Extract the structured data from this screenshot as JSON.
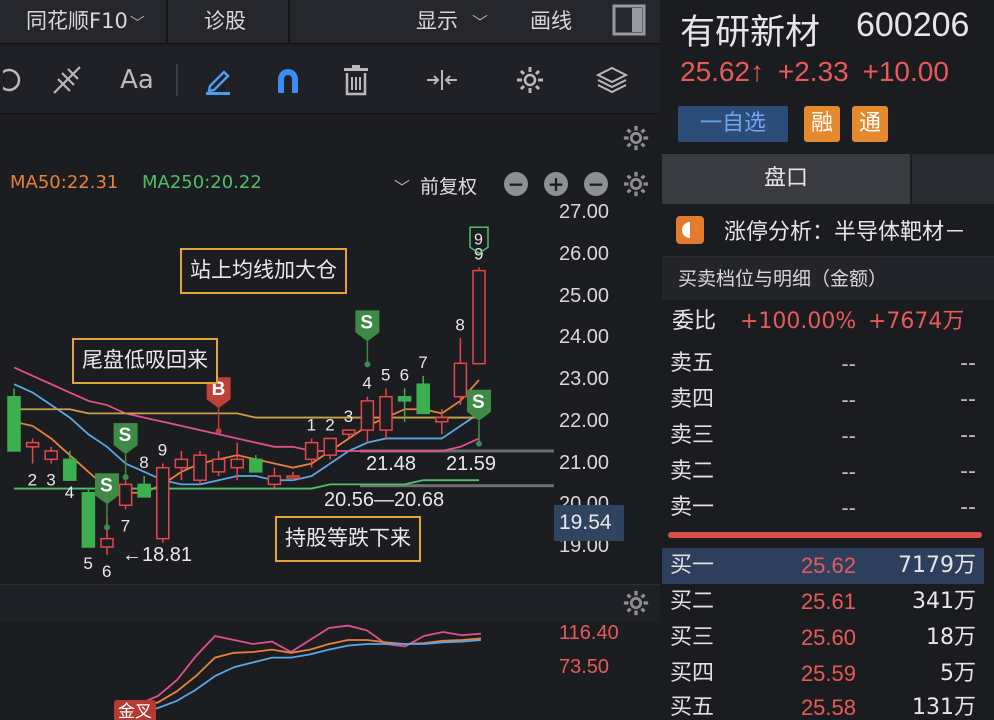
{
  "topbar": {
    "app_label": "同花顺F10",
    "diagnose_label": "诊股",
    "display_label": "显示",
    "draw_label": "画线"
  },
  "toolbar": {
    "font_label": "Aa"
  },
  "ma_row": {
    "ma50": "MA50:22.31",
    "ma250": "MA250:20.22",
    "adjust_label": "前复权",
    "colors": {
      "ma50": "#e8813a",
      "ma250": "#4fbf6a"
    }
  },
  "chart_data": {
    "type": "candlestick",
    "ylim": [
      18.8,
      27.2
    ],
    "y_ticks": [
      "27.00",
      "26.00",
      "25.00",
      "24.00",
      "23.00",
      "22.00",
      "21.00",
      "20.00",
      "19.00"
    ],
    "current_price": "19.54",
    "candles": [
      {
        "o": 22.6,
        "h": 22.8,
        "l": 21.3,
        "c": 21.3
      },
      {
        "o": 21.4,
        "h": 21.6,
        "l": 21.0,
        "c": 21.5
      },
      {
        "o": 21.1,
        "h": 21.4,
        "l": 21.0,
        "c": 21.3
      },
      {
        "o": 21.1,
        "h": 21.3,
        "l": 20.7,
        "c": 20.6
      },
      {
        "o": 20.3,
        "h": 20.4,
        "l": 19.0,
        "c": 19.0
      },
      {
        "o": 19.0,
        "h": 19.7,
        "l": 18.81,
        "c": 19.2
      },
      {
        "o": 20.0,
        "h": 20.6,
        "l": 19.9,
        "c": 20.5
      },
      {
        "o": 20.5,
        "h": 20.7,
        "l": 20.2,
        "c": 20.2
      },
      {
        "o": 19.2,
        "h": 21.0,
        "l": 19.1,
        "c": 20.9
      },
      {
        "o": 20.9,
        "h": 21.3,
        "l": 20.6,
        "c": 21.1
      },
      {
        "o": 20.6,
        "h": 21.3,
        "l": 20.5,
        "c": 21.2
      },
      {
        "o": 20.8,
        "h": 21.3,
        "l": 20.7,
        "c": 21.1
      },
      {
        "o": 20.9,
        "h": 21.5,
        "l": 20.6,
        "c": 21.1
      },
      {
        "o": 21.1,
        "h": 21.2,
        "l": 20.8,
        "c": 20.8
      },
      {
        "o": 20.5,
        "h": 20.9,
        "l": 20.4,
        "c": 20.7
      },
      {
        "o": 20.7,
        "h": 20.8,
        "l": 20.6,
        "c": 20.7
      },
      {
        "o": 21.1,
        "h": 21.6,
        "l": 20.9,
        "c": 21.5
      },
      {
        "o": 21.2,
        "h": 21.6,
        "l": 21.1,
        "c": 21.6
      },
      {
        "o": 21.7,
        "h": 21.8,
        "l": 21.6,
        "c": 21.8
      },
      {
        "o": 21.8,
        "h": 22.6,
        "l": 21.5,
        "c": 22.5
      },
      {
        "o": 21.8,
        "h": 22.8,
        "l": 21.6,
        "c": 22.6
      },
      {
        "o": 22.6,
        "h": 22.8,
        "l": 22.0,
        "c": 22.5
      },
      {
        "o": 22.9,
        "h": 23.1,
        "l": 22.2,
        "c": 22.2
      },
      {
        "o": 22.0,
        "h": 22.3,
        "l": 21.7,
        "c": 22.1
      },
      {
        "o": 22.6,
        "h": 24.0,
        "l": 22.4,
        "c": 23.4
      },
      {
        "o": 23.39,
        "h": 25.7,
        "l": 23.39,
        "c": 25.62
      }
    ],
    "candle_labels": [
      "",
      "2",
      "3",
      "4",
      "5",
      "6",
      "7",
      "8",
      "9",
      "",
      "",
      "",
      "",
      "",
      "",
      "",
      "1",
      "2",
      "3",
      "4",
      "5",
      "6",
      "7",
      "",
      "8",
      "9"
    ],
    "ma_lines": [
      {
        "name": "MA50",
        "color": "#e8813a",
        "values": [
          22.0,
          21.9,
          21.6,
          21.2,
          20.8,
          20.4,
          20.3,
          20.3,
          20.5,
          20.8,
          21.0,
          21.1,
          21.2,
          21.1,
          21.0,
          20.9,
          21.0,
          21.3,
          21.6,
          21.9,
          22.1,
          22.3,
          22.3,
          22.2,
          22.5,
          23.0
        ]
      },
      {
        "name": "MA250",
        "color": "#4fbf6a",
        "values": [
          20.4,
          20.4,
          20.4,
          20.4,
          20.4,
          20.4,
          20.4,
          20.4,
          20.4,
          20.4,
          20.4,
          20.4,
          20.4,
          20.4,
          20.4,
          20.4,
          20.4,
          20.5,
          20.5,
          20.5,
          20.5,
          20.5,
          20.6,
          20.6,
          20.6,
          20.6
        ]
      },
      {
        "name": "",
        "color": "#5aa7e6",
        "values": [
          22.9,
          22.7,
          22.4,
          22.1,
          21.7,
          21.4,
          21.0,
          20.8,
          20.6,
          20.5,
          20.5,
          20.6,
          20.7,
          20.7,
          20.6,
          20.6,
          20.7,
          21.0,
          21.3,
          21.5,
          21.6,
          21.6,
          21.6,
          21.6,
          21.9,
          22.2
        ]
      },
      {
        "name": "",
        "color": "#e0508f",
        "values": [
          23.3,
          23.1,
          22.9,
          22.7,
          22.5,
          22.4,
          22.2,
          22.1,
          22.0,
          21.9,
          21.8,
          21.7,
          21.6,
          21.5,
          21.4,
          21.4,
          21.3,
          21.3,
          21.3,
          21.3,
          21.3,
          21.3,
          21.3,
          21.3,
          21.4,
          21.6
        ]
      },
      {
        "name": "",
        "color": "#c9a24a",
        "values": [
          22.3,
          22.3,
          22.3,
          22.3,
          22.2,
          22.2,
          22.2,
          22.2,
          22.2,
          22.2,
          22.2,
          22.2,
          22.2,
          22.1,
          22.1,
          22.1,
          22.1,
          22.1,
          22.1,
          22.1,
          22.1,
          22.1,
          22.1,
          22.1,
          22.1,
          22.1
        ]
      }
    ],
    "signals": [
      {
        "label": "S",
        "idx": 5,
        "price": 20.0
      },
      {
        "label": "S",
        "idx": 6,
        "price": 21.2
      },
      {
        "label": "B",
        "idx": 11,
        "price": 22.3
      },
      {
        "label": "S",
        "idx": 19,
        "price": 23.9
      },
      {
        "label": "S",
        "idx": 25,
        "price": 22.0
      }
    ],
    "price_notes": [
      "←18.81",
      "21.48",
      "21.59",
      "20.56—20.68"
    ],
    "annotations": [
      "站上均线加大仓",
      "尾盘低吸回来",
      "持股等跌下来"
    ],
    "top_badge": "9",
    "sub_ticks": [
      "116.40",
      "73.50"
    ],
    "sub_badge": "金叉",
    "sub_lines": [
      {
        "color": "#e0508f",
        "values": [
          10,
          20,
          30,
          50,
          80,
          105,
          100,
          95,
          98,
          85,
          100,
          115,
          118,
          112,
          95,
          92,
          105,
          110,
          106,
          108
        ]
      },
      {
        "color": "#e8813a",
        "values": [
          8,
          15,
          22,
          36,
          55,
          78,
          84,
          85,
          88,
          84,
          88,
          95,
          100,
          100,
          97,
          95,
          96,
          99,
          100,
          102
        ]
      },
      {
        "color": "#5aa7e6",
        "values": [
          5,
          10,
          15,
          24,
          38,
          55,
          66,
          72,
          78,
          78,
          82,
          88,
          93,
          95,
          95,
          95,
          95,
          97,
          98,
          100
        ]
      }
    ]
  },
  "stock": {
    "name": "有研新材",
    "code": "600206",
    "price": "25.62",
    "arrow": "↑",
    "change": "+2.33",
    "change_pct": "+10.00",
    "watch_label": "一自选",
    "tag1": "融",
    "tag2": "通",
    "tab_label": "盘口",
    "limitup": "涨停分析：半导体靶材－"
  },
  "orderbook": {
    "title": "买卖档位与明细（金额）",
    "weibi_label": "委比",
    "weibi_pct": "+100.00%",
    "weibi_amt": "+7674万",
    "sells": [
      {
        "label": "卖五",
        "price": "--",
        "vol": "--"
      },
      {
        "label": "卖四",
        "price": "--",
        "vol": "--"
      },
      {
        "label": "卖三",
        "price": "--",
        "vol": "--"
      },
      {
        "label": "卖二",
        "price": "--",
        "vol": "--"
      },
      {
        "label": "卖一",
        "price": "--",
        "vol": "--"
      }
    ],
    "buys": [
      {
        "label": "买一",
        "price": "25.62",
        "vol": "7179万"
      },
      {
        "label": "买二",
        "price": "25.61",
        "vol": "341万"
      },
      {
        "label": "买三",
        "price": "25.60",
        "vol": "18万"
      },
      {
        "label": "买四",
        "price": "25.59",
        "vol": "5万"
      },
      {
        "label": "买五",
        "price": "25.58",
        "vol": "131万"
      }
    ]
  }
}
